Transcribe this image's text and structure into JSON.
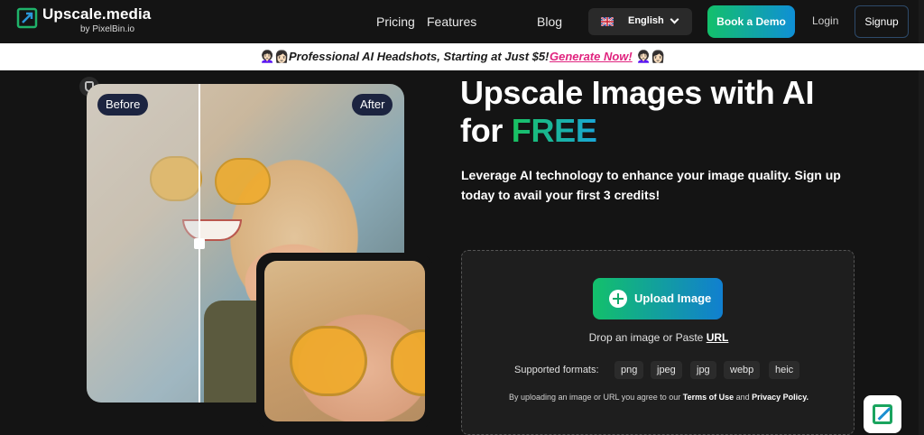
{
  "header": {
    "brand_name": "Upscale.media",
    "brand_sub": "by PixelBin.io",
    "nav": [
      "Pricing",
      "Features",
      "Blog"
    ],
    "language": "English",
    "book_demo": "Book a Demo",
    "login": "Login",
    "signup": "Signup"
  },
  "banner": {
    "promo_text": "Professional AI Headshots, Starting at Just $5!",
    "cta": "Generate Now!",
    "emoji": "👩🏻‍🦱👩🏻"
  },
  "comparison": {
    "before_label": "Before",
    "after_label": "After"
  },
  "hero": {
    "title_line1": "Upscale Images with AI",
    "title_line2_prefix": "for ",
    "title_line2_highlight": "FREE",
    "subtitle": "Leverage AI technology to enhance your image quality. Sign up today to avail your first 3 credits!"
  },
  "upload": {
    "button_label": "Upload Image",
    "drop_text": "Drop an image or Paste ",
    "url_link": "URL",
    "formats_label": "Supported formats:",
    "formats": [
      "png",
      "jpeg",
      "jpg",
      "webp",
      "heic"
    ],
    "terms_prefix": "By uploading an image or URL you agree to our ",
    "terms_link": "Terms of Use",
    "terms_and": " and ",
    "privacy_link": "Privacy Policy."
  },
  "colors": {
    "accent_green": "#13c06b",
    "accent_blue": "#117fd0",
    "promo_pink": "#e0247f",
    "background": "#141414"
  }
}
